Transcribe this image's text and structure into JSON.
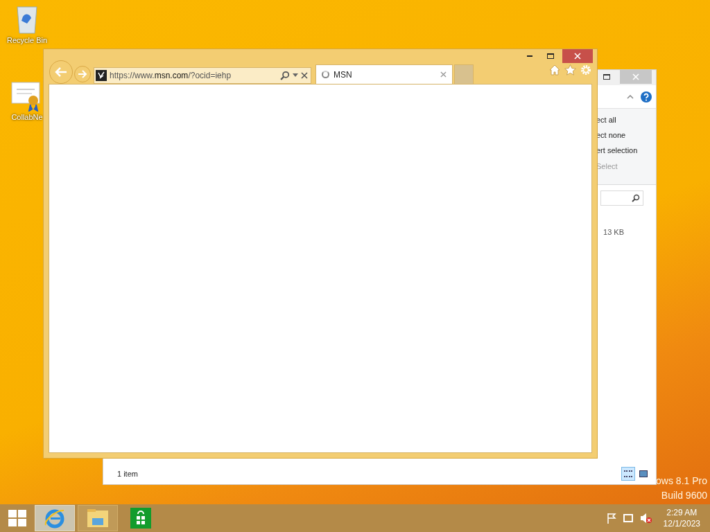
{
  "desktop_icons": [
    {
      "label": "Recycle Bin",
      "kind": "bin"
    },
    {
      "label": "CollabNe",
      "kind": "certificate"
    }
  ],
  "explorer": {
    "ribbon_items": [
      "ect all",
      "ect none",
      "ert selection"
    ],
    "ribbon_group": "Select",
    "file_size": "13 KB",
    "status": "1 item",
    "views": [
      {
        "kind": "details",
        "selected": true
      },
      {
        "kind": "large",
        "selected": false
      }
    ]
  },
  "browser": {
    "address": "https://www.**msn.com**/?ocid=iehp",
    "tab": {
      "title": "MSN",
      "loading": true
    }
  },
  "edition": [
    "ows 8.1 Pro",
    "Build 9600"
  ],
  "taskbar": {
    "apps": [
      {
        "kind": "ie",
        "selected": true
      },
      {
        "kind": "explorer",
        "selected": false
      },
      {
        "kind": "store",
        "selected": false
      }
    ],
    "time": "2:29 AM",
    "date": "12/1/2023"
  }
}
